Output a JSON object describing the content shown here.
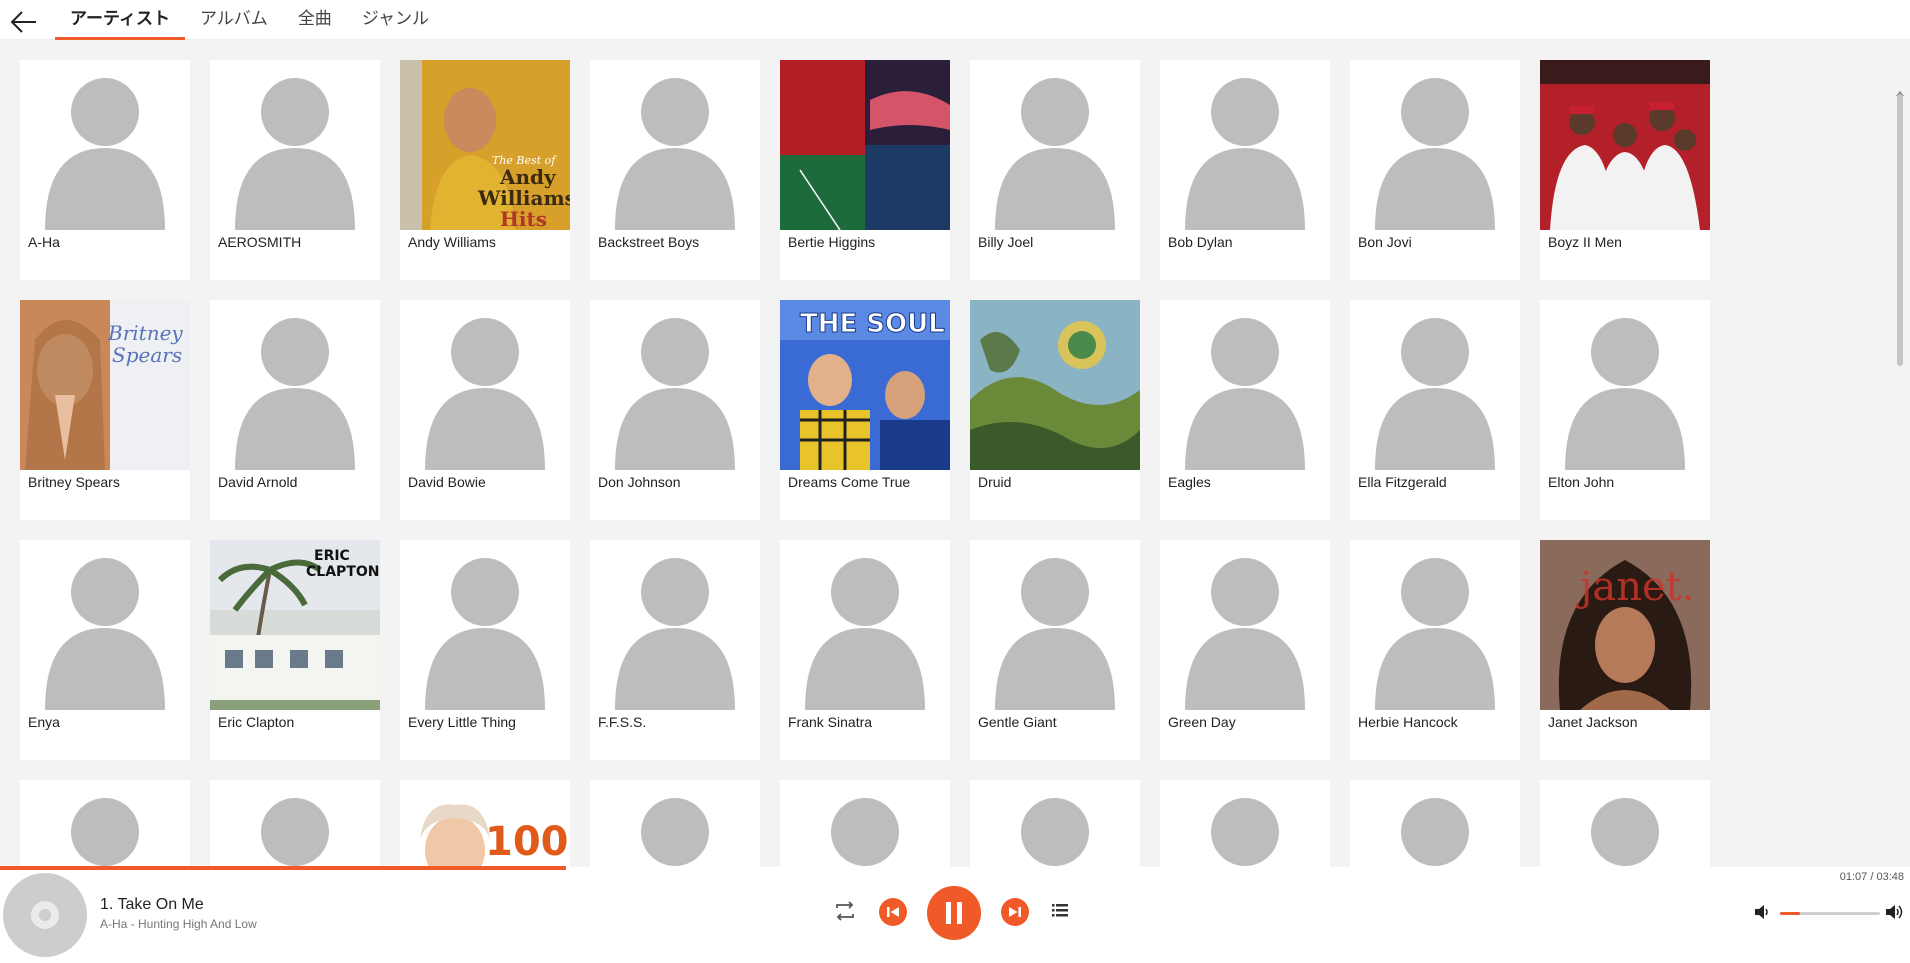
{
  "tabs": [
    {
      "label": "アーティスト",
      "active": true
    },
    {
      "label": "アルバム",
      "active": false
    },
    {
      "label": "全曲",
      "active": false
    },
    {
      "label": "ジャンル",
      "active": false
    }
  ],
  "artists": [
    {
      "name": "A-Ha",
      "art": "avatar"
    },
    {
      "name": "AEROSMITH",
      "art": "avatar"
    },
    {
      "name": "Andy Williams",
      "art": "andy"
    },
    {
      "name": "Backstreet Boys",
      "art": "avatar"
    },
    {
      "name": "Bertie Higgins",
      "art": "bertie"
    },
    {
      "name": "Billy Joel",
      "art": "avatar"
    },
    {
      "name": "Bob Dylan",
      "art": "avatar"
    },
    {
      "name": "Bon Jovi",
      "art": "avatar"
    },
    {
      "name": "Boyz II Men",
      "art": "boyz"
    },
    {
      "name": "Britney Spears",
      "art": "britney"
    },
    {
      "name": "David Arnold",
      "art": "avatar"
    },
    {
      "name": "David Bowie",
      "art": "avatar"
    },
    {
      "name": "Don Johnson",
      "art": "avatar"
    },
    {
      "name": "Dreams Come True",
      "art": "dreams"
    },
    {
      "name": "Druid",
      "art": "druid"
    },
    {
      "name": "Eagles",
      "art": "avatar"
    },
    {
      "name": "Ella Fitzgerald",
      "art": "avatar"
    },
    {
      "name": "Elton John",
      "art": "avatar"
    },
    {
      "name": "Enya",
      "art": "avatar"
    },
    {
      "name": "Eric Clapton",
      "art": "clapton"
    },
    {
      "name": "Every Little Thing",
      "art": "avatar"
    },
    {
      "name": "F.F.S.S.",
      "art": "avatar"
    },
    {
      "name": "Frank Sinatra",
      "art": "avatar"
    },
    {
      "name": "Gentle Giant",
      "art": "avatar"
    },
    {
      "name": "Green Day",
      "art": "avatar"
    },
    {
      "name": "Herbie Hancock",
      "art": "avatar"
    },
    {
      "name": "Janet Jackson",
      "art": "janet"
    },
    {
      "name": "",
      "art": "avatar"
    },
    {
      "name": "",
      "art": "avatar"
    },
    {
      "name": "",
      "art": "bach"
    },
    {
      "name": "",
      "art": "avatar"
    },
    {
      "name": "",
      "art": "avatar"
    },
    {
      "name": "",
      "art": "avatar"
    },
    {
      "name": "",
      "art": "avatar"
    },
    {
      "name": "",
      "art": "avatar"
    },
    {
      "name": "",
      "art": "avatar"
    }
  ],
  "cover_text": {
    "andy_1": "The Best of",
    "andy_2": "Andy",
    "andy_3": "Williams",
    "andy_4": "Hits",
    "britney_1": "Britney",
    "britney_2": "Spears",
    "dreams": "THE SOUL",
    "clapton_1": "ERIC",
    "clapton_2": "CLAPTON",
    "janet": "janet.",
    "bach": "100"
  },
  "player": {
    "track_title": "1. Take On Me",
    "track_subtitle": "A-Ha - Hunting High And Low",
    "time": "01:07 / 03:48",
    "progress_fraction": 0.29,
    "volume_fraction": 0.2,
    "accent_color": "#f05a28",
    "icons": [
      "repeat-icon",
      "previous-icon",
      "pause-icon",
      "next-icon",
      "queue-icon",
      "volume-down-icon",
      "volume-up-icon"
    ]
  }
}
